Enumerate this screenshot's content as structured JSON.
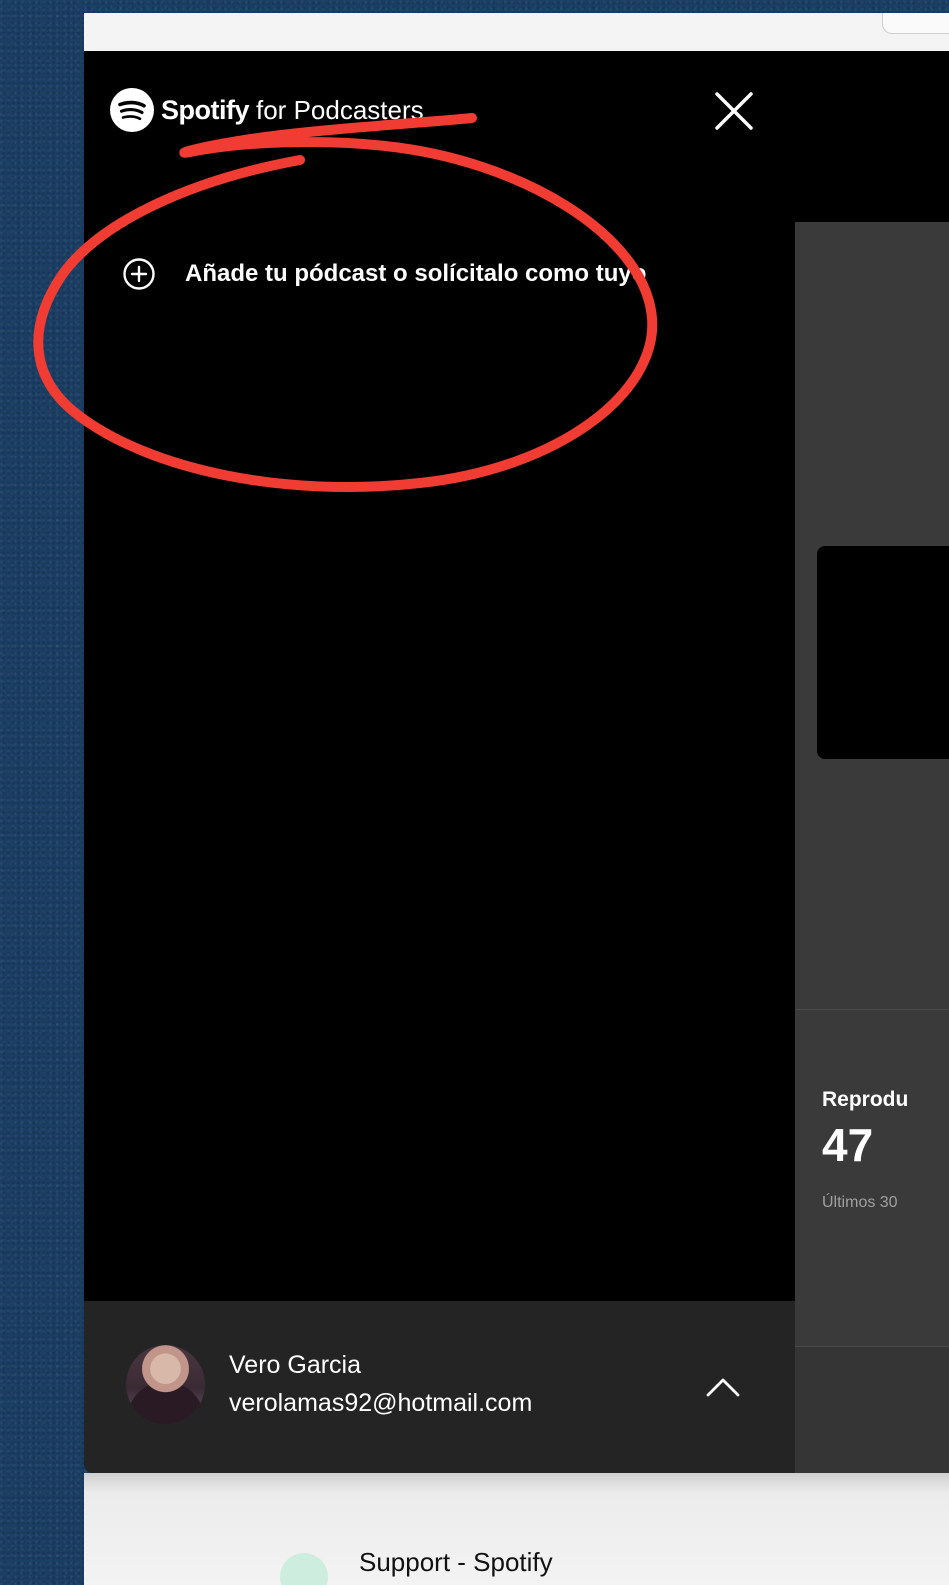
{
  "app": {
    "brand_name": "Spotify",
    "brand_suffix": "for Podcasters"
  },
  "drawer": {
    "add_podcast_label": "Añade tu pódcast o solícitalo como tuyo",
    "add_icon": "plus-circle-icon",
    "close_icon": "close-icon"
  },
  "user": {
    "name": "Vero Garcia",
    "email": "verolamas92@hotmail.com",
    "expand_icon": "chevron-up-icon"
  },
  "main": {
    "stat_label": "Reprodu",
    "stat_value": "47",
    "stat_sub": "Últimos 30"
  },
  "page_below": {
    "support_label": "Support - Spotify"
  },
  "colors": {
    "annotation_red": "#f03c32",
    "drawer_bg": "#000000",
    "user_panel_bg": "#242424",
    "main_bg": "#3a3a3a",
    "desktop_bg": "#1b3e64"
  }
}
